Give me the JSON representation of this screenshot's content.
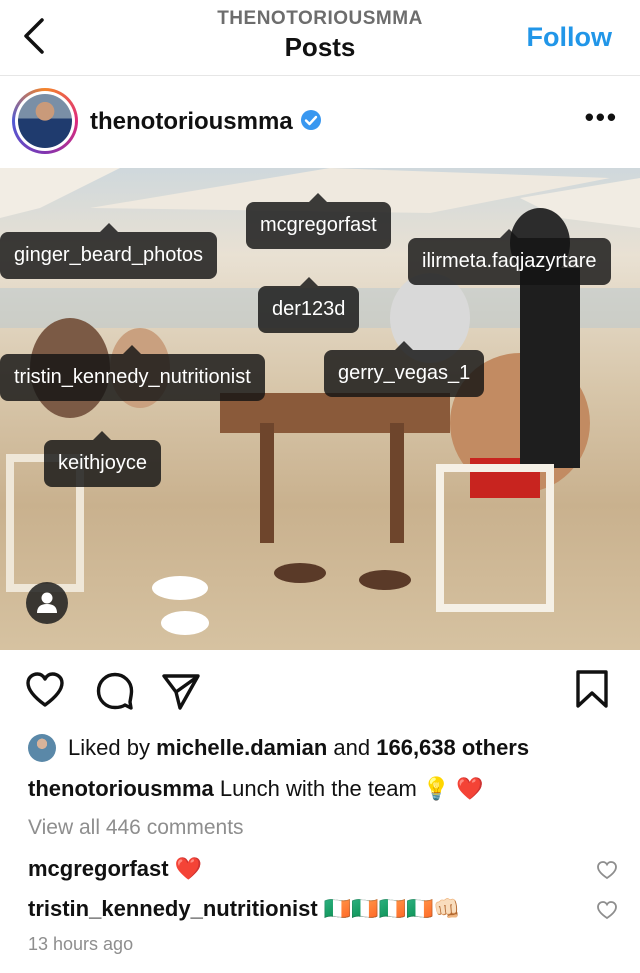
{
  "header": {
    "account": "THENOTORIOUSMMA",
    "title": "Posts",
    "follow_label": "Follow",
    "back_icon": "chevron-left-icon"
  },
  "post": {
    "username": "thenotoriousmma",
    "verified": true,
    "more_icon": "more-horizontal-icon",
    "more_label": "•••",
    "tags": [
      {
        "label": "mcgregorfast"
      },
      {
        "label": "ginger_beard_photos"
      },
      {
        "label": "ilirmeta.faqjazyrtare"
      },
      {
        "label": "der123d"
      },
      {
        "label": "tristin_kennedy_nutritionist"
      },
      {
        "label": "gerry_vegas_1"
      },
      {
        "label": "keithjoyce"
      }
    ],
    "likes": {
      "prefix": "Liked by",
      "user": "michelle.damian",
      "connector": "and",
      "count": "166,638 others"
    },
    "caption": {
      "user": "thenotoriousmma",
      "text": "Lunch with the team 💡 ❤️"
    },
    "view_all_comments": "View all 446 comments",
    "comments": [
      {
        "user": "mcgregorfast",
        "text": "❤️"
      },
      {
        "user": "tristin_kennedy_nutritionist",
        "text": "🇮🇪🇮🇪🇮🇪🇮🇪👊🏻"
      }
    ],
    "timestamp": "13 hours ago"
  },
  "colors": {
    "accent": "#2196e8",
    "verified": "#3897f0",
    "muted": "#8e8e8e"
  }
}
